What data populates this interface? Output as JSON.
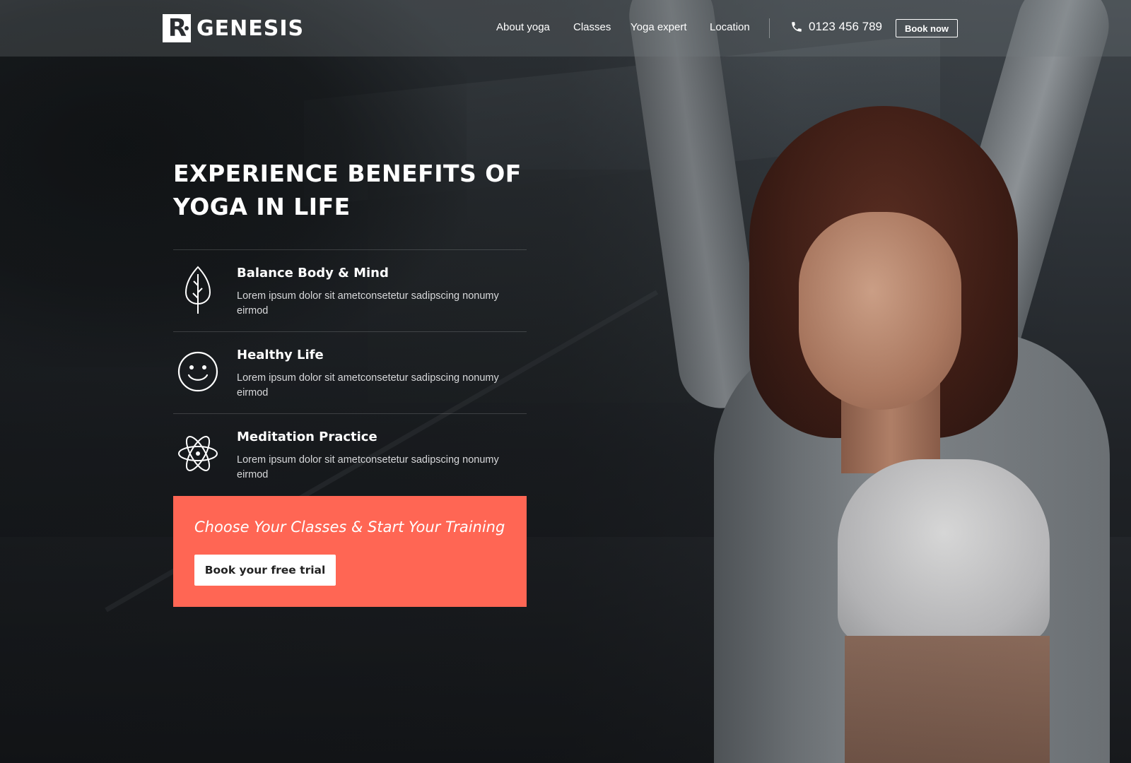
{
  "brand": {
    "logo_mark": "R",
    "name": "GENESIS"
  },
  "nav": {
    "items": [
      {
        "label": "About yoga"
      },
      {
        "label": "Classes"
      },
      {
        "label": "Yoga expert"
      },
      {
        "label": "Location"
      }
    ],
    "phone": "0123 456 789",
    "book_now_label": "Book now"
  },
  "hero": {
    "title": "EXPERIENCE BENEFITS OF YOGA IN LIFE",
    "features": [
      {
        "title": "Balance Body & Mind",
        "description": "Lorem ipsum dolor sit ametconsetetur sadipscing nonumy eirmod",
        "icon": "leaf-icon"
      },
      {
        "title": "Healthy Life",
        "description": "Lorem ipsum dolor sit ametconsetetur sadipscing nonumy eirmod",
        "icon": "smiley-face-icon"
      },
      {
        "title": "Meditation Practice",
        "description": "Lorem ipsum dolor sit ametconsetetur sadipscing nonumy eirmod",
        "icon": "atom-icon"
      }
    ]
  },
  "cta": {
    "text": "Choose Your Classes & Start Your Training",
    "button_label": "Book your free trial"
  },
  "colors": {
    "accent": "#ff6654",
    "header_overlay": "#7c8084",
    "text_light": "#ffffff"
  }
}
